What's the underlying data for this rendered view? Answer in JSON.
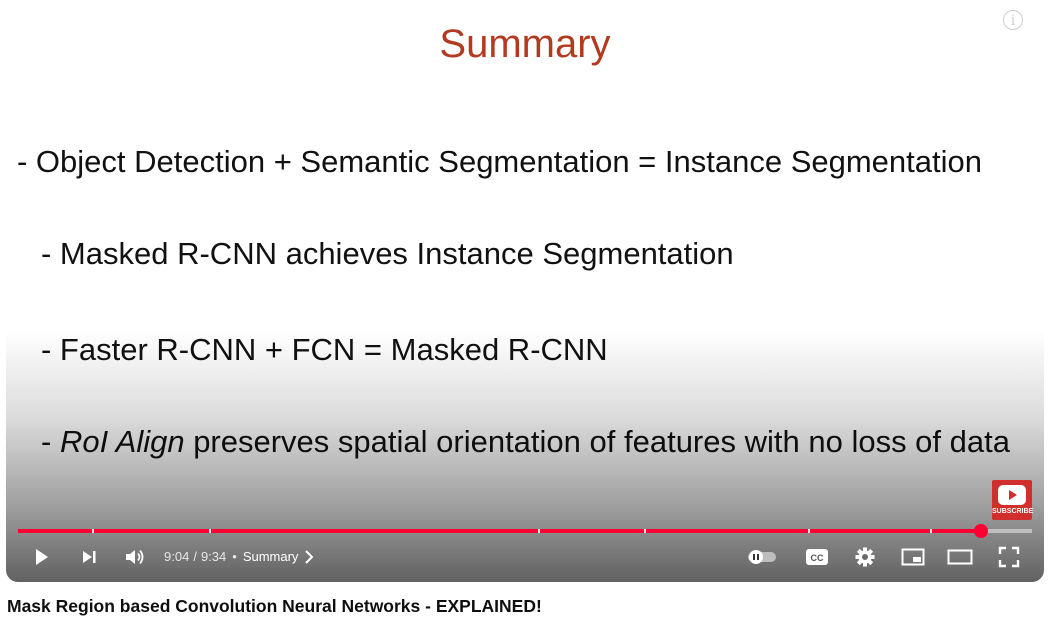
{
  "slide": {
    "title": "Summary",
    "bullets": [
      "- Object Detection + Semantic Segmentation = Instance Segmentation",
      "- Masked R-CNN achieves Instance Segmentation",
      "- Faster R-CNN + FCN = Masked R-CNN"
    ],
    "bullet4": {
      "prefix": "- ",
      "italic": "RoI Align",
      "rest": " preserves spatial orientation of features with no loss of data"
    }
  },
  "overlay": {
    "subscribe_label": "SUBSCRIBE",
    "info_icon": "info-icon"
  },
  "player": {
    "current_time": "9:04",
    "time_separator": "/",
    "duration": "9:34",
    "chapter_bullet": "•",
    "chapter": "Summary",
    "progress_fraction": 0.947,
    "accent_color": "#ff0033",
    "icons": [
      "play-icon",
      "next-icon",
      "volume-icon",
      "chevron-right-icon",
      "autoplay-toggle-icon",
      "cc-icon",
      "settings-icon",
      "miniplayer-icon",
      "theater-icon",
      "fullscreen-icon"
    ]
  },
  "video": {
    "title": "Mask Region based Convolution Neural Networks - EXPLAINED!"
  }
}
